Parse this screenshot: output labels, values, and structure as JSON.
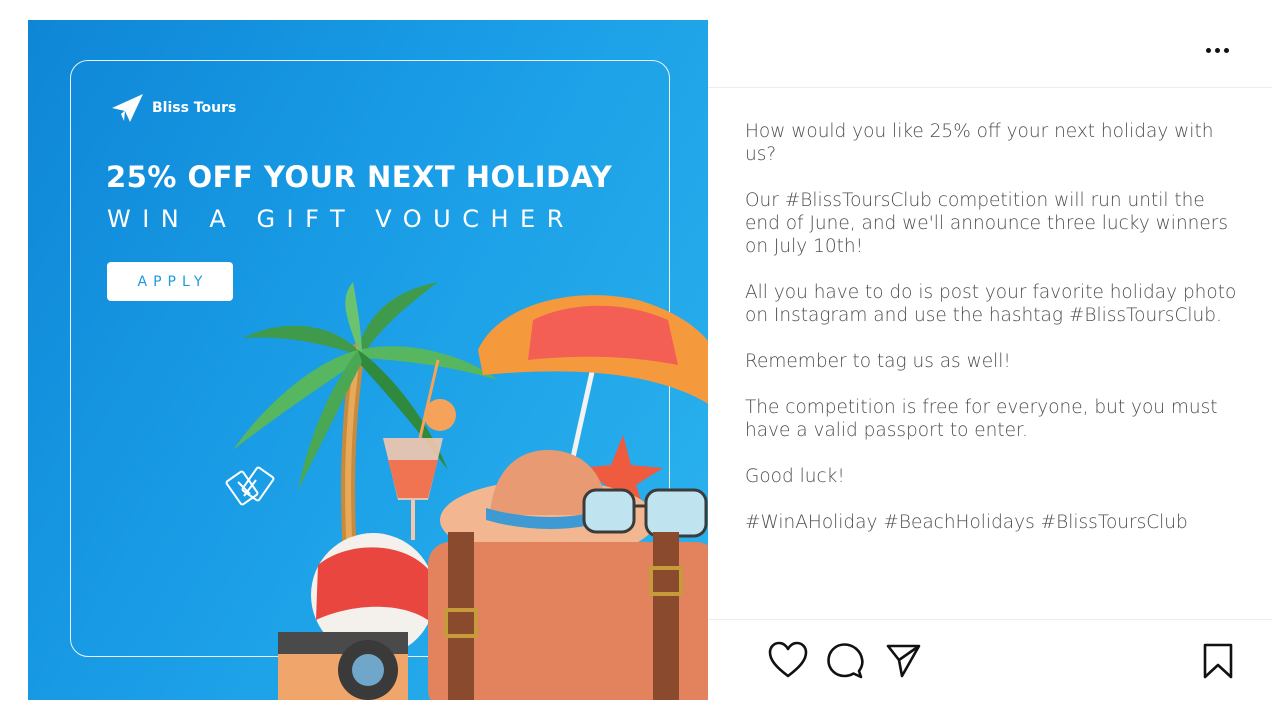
{
  "post": {
    "brand_name": "Bliss Tours",
    "headline": "25% OFF YOUR NEXT HOLIDAY",
    "subline": "WIN A GIFT VOUCHER",
    "apply_label": "APPLY",
    "brand_color": "#1a9de6"
  },
  "header": {
    "more_icon": "more-horizontal-icon"
  },
  "caption": {
    "paragraphs": [
      "How would you like 25% off your next holiday with us?",
      "Our #BlissToursClub competition will run until the end of June, and we'll announce three lucky winners on July 10th!",
      "All you have to do is post your favorite holiday photo on Instagram and use the hashtag #BlissToursClub.",
      "Remember to tag us as well!",
      "The competition is free for everyone, but you must have a valid passport to enter.",
      "Good luck!",
      "#WinAHoliday #BeachHolidays #BlissToursClub"
    ]
  },
  "actions": {
    "like_icon": "heart-icon",
    "comment_icon": "comment-icon",
    "share_icon": "send-icon",
    "save_icon": "bookmark-icon"
  }
}
